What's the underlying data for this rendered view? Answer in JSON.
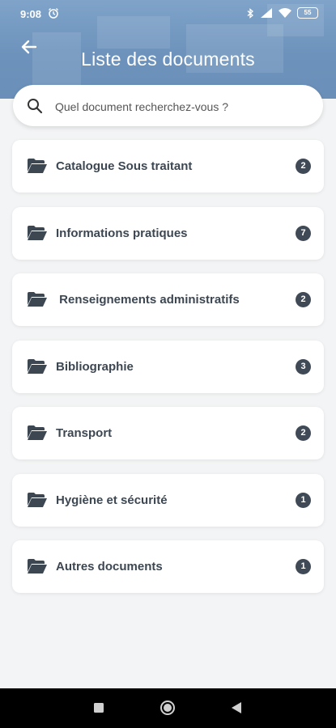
{
  "status_bar": {
    "time": "9:08",
    "battery": "55"
  },
  "header": {
    "title": "Liste des documents"
  },
  "search": {
    "placeholder": "Quel document recherchez-vous ?"
  },
  "documents": [
    {
      "label": "Catalogue Sous traitant",
      "count": "2"
    },
    {
      "label": "Informations pratiques",
      "count": "7"
    },
    {
      "label": " Renseignements administratifs",
      "count": "2"
    },
    {
      "label": "Bibliographie",
      "count": "3"
    },
    {
      "label": "Transport",
      "count": "2"
    },
    {
      "label": "Hygiène et sécurité",
      "count": "1"
    },
    {
      "label": "Autres documents",
      "count": "1"
    }
  ],
  "colors": {
    "header": "#6d93bc",
    "text": "#3d4752",
    "badge": "#404a56",
    "background": "#f3f4f5"
  }
}
